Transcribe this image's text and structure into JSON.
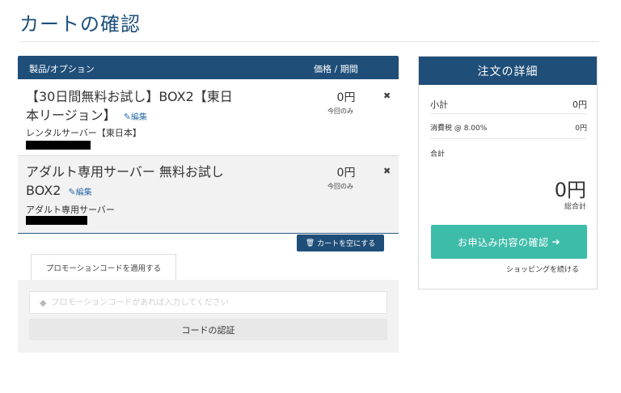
{
  "page": {
    "title": "カートの確認"
  },
  "cart": {
    "header": {
      "product": "製品/オプション",
      "price": "価格 / 期間"
    },
    "items": [
      {
        "title": "【30日間無料お試し】BOX2【東日本リージョン】",
        "edit": "編集",
        "subtitle": "レンタルサーバー【東日本】",
        "price": "0円",
        "price_note": "今回のみ",
        "remove": "✖"
      },
      {
        "title": "アダルト専用サーバー 無料お試しBOX2",
        "edit": "編集",
        "subtitle": "アダルト専用サーバー",
        "price": "0円",
        "price_note": "今回のみ",
        "remove": "✖"
      }
    ],
    "empty_button": "カートを空にする"
  },
  "promo": {
    "tab": "プロモーションコードを適用する",
    "placeholder": "プロモーションコードがあれば入力してください",
    "verify_button": "コードの認証"
  },
  "summary": {
    "title": "注文の詳細",
    "subtotal_label": "小計",
    "subtotal_value": "0円",
    "tax_label": "消費税 @ 8.00%",
    "tax_value": "0円",
    "total_label": "合計",
    "total_value": "0円",
    "total_note": "総合計",
    "checkout_button": "お申込み内容の確認",
    "continue_link": "ショッピングを続ける"
  },
  "icons": {
    "edit": "pencil-icon",
    "remove": "close-icon",
    "trash": "trash-icon",
    "tag": "tag-icon",
    "arrow": "arrow-right-icon"
  },
  "colors": {
    "header": "#1f4f79",
    "checkout": "#3ebcaa",
    "title": "#1d4f7a"
  }
}
